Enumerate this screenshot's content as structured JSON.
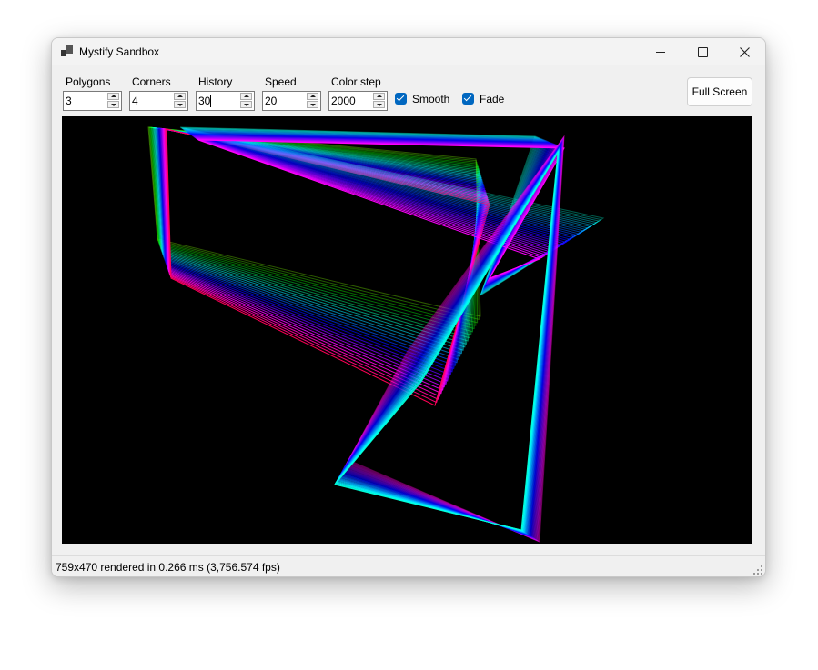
{
  "window": {
    "title": "Mystify Sandbox",
    "controls": {
      "minimize": "minimize",
      "maximize": "maximize",
      "close": "close"
    }
  },
  "toolbar": {
    "polygons": {
      "label": "Polygons",
      "value": "3"
    },
    "corners": {
      "label": "Corners",
      "value": "4"
    },
    "history": {
      "label": "History",
      "value": "30"
    },
    "speed": {
      "label": "Speed",
      "value": "20"
    },
    "color_step": {
      "label": "Color step",
      "value": "2000"
    },
    "smooth": {
      "label": "Smooth",
      "checked": true
    },
    "fade": {
      "label": "Fade",
      "checked": true
    },
    "fullscreen_label": "Full Screen"
  },
  "canvas": {
    "background": "#000000"
  },
  "status": {
    "text": "759x470 rendered in 0.266 ms (3,756.574 fps)"
  },
  "colors": {
    "accent": "#0067c0"
  }
}
